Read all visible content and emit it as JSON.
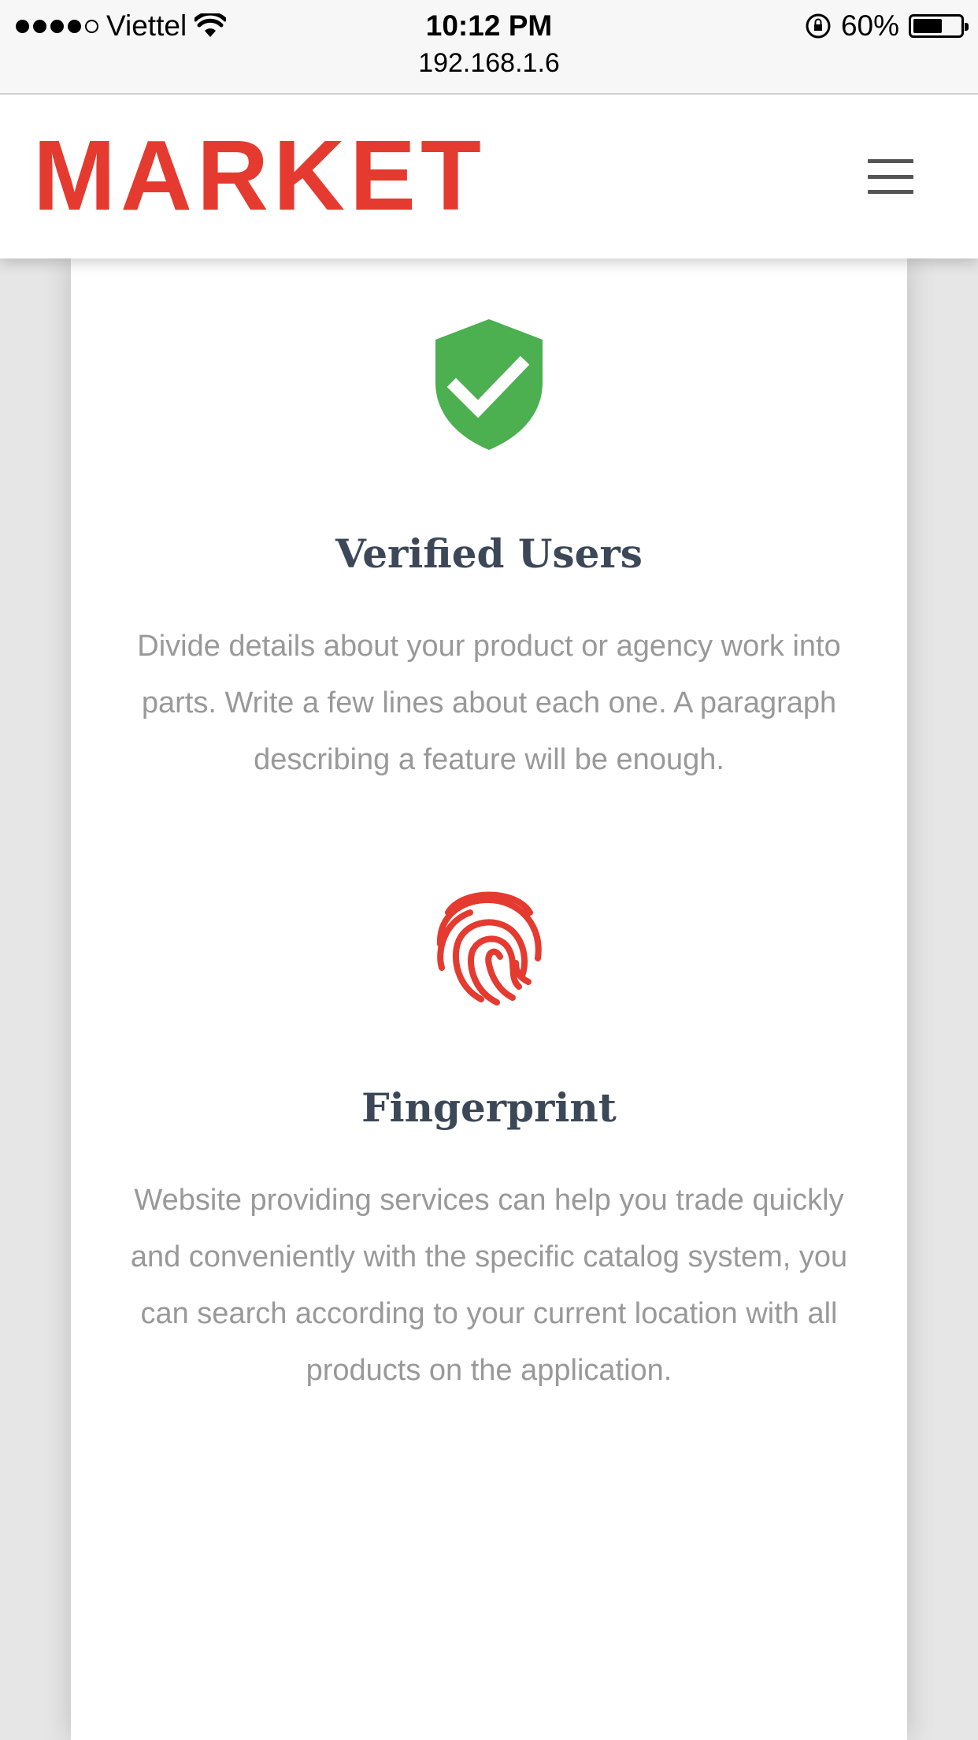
{
  "status_bar": {
    "carrier": "Viettel",
    "time": "10:12 PM",
    "battery_percent": "60%",
    "battery_level": 0.6,
    "url": "192.168.1.6"
  },
  "header": {
    "logo_text": "MARKET",
    "brand_color": "#e53a2f"
  },
  "features": [
    {
      "icon": "shield-check-icon",
      "icon_color": "#4caf50",
      "title": "Verified Users",
      "description": "Divide details about your product or agency work into parts. Write a few lines about each one. A paragraph describing a feature will be enough."
    },
    {
      "icon": "fingerprint-icon",
      "icon_color": "#e53a2f",
      "title": "Fingerprint",
      "description": "Website providing services can help you trade quickly and conveniently with the specific catalog system, you can search according to your current location with all products on the application."
    }
  ]
}
